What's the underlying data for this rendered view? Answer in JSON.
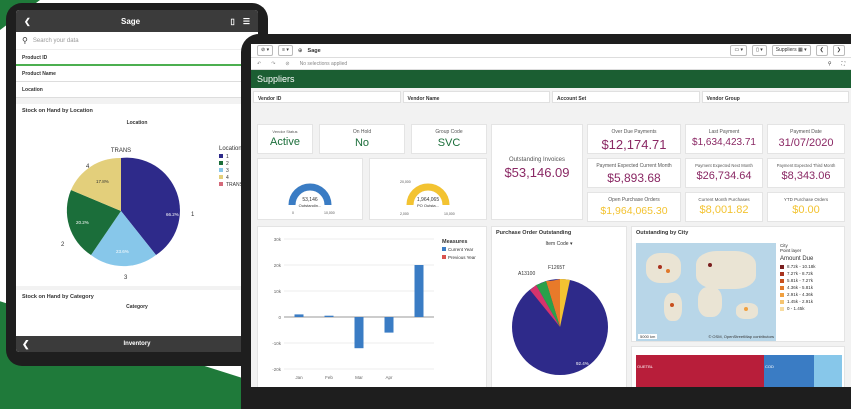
{
  "phone": {
    "title": "Sage",
    "search_placeholder": "Search your data",
    "fields": [
      "Product ID",
      "Product Name",
      "Location"
    ],
    "section_location": "Stock on Hand by Location",
    "location_chart_title": "Location",
    "pie_top_label": "TRANS",
    "legend_title": "Location",
    "legend_items": [
      "1",
      "2",
      "3",
      "4",
      "TRANS"
    ],
    "pie_outer_labels": [
      "1",
      "2",
      "3",
      "4"
    ],
    "pie_inner_labels": [
      "66.2%",
      "23.6%",
      "20.2%",
      "17.8%"
    ],
    "section_category": "Stock on Hand by Category",
    "category_chart_title": "Category",
    "bottom_title": "Inventory",
    "colors": {
      "dark": "#3b3b3b",
      "accent": "#4caf50"
    }
  },
  "tablet": {
    "toolbar_title": "Sage",
    "suppliers_label": "Suppliers",
    "selections_text": "No selections applied",
    "header_title": "Suppliers",
    "filters": [
      "Vendor ID",
      "Vendor Name",
      "Account Set",
      "Vendor Group"
    ],
    "vendor_status_label": "Vendor Status",
    "vendor_status_value": "Active",
    "on_hold_label": "On Hold",
    "on_hold_value": "No",
    "group_code_label": "Group Code",
    "group_code_value": "SVC",
    "gauge1_value": "53,146",
    "gauge1_sub": "Outstandin...",
    "gauge1_min": "0",
    "gauge1_max": "10,000",
    "gauge2_value": "1,964,065",
    "gauge2_sub": "PO Outsta...",
    "gauge2_min": "2,000",
    "gauge2_max": "10,000",
    "gauge2_top": "20,000",
    "outstanding_invoices_label": "Outstanding Invoices",
    "outstanding_invoices_value": "$53,146.09",
    "kpis": [
      {
        "label": "Over Due Payments",
        "value": "$12,174.71"
      },
      {
        "label": "Last Payment",
        "value": "$1,634,423.71"
      },
      {
        "label": "Payment Date",
        "value": "31/07/2020"
      },
      {
        "label": "Payment Expected Current Month",
        "value": "$5,893.68"
      },
      {
        "label": "Payment Expected Next Month",
        "value": "$26,734.64"
      },
      {
        "label": "Payment Expected Third Month",
        "value": "$8,343.06"
      },
      {
        "label": "Open Purchase Orders",
        "value": "$1,964,065.30"
      },
      {
        "label": "Current Month Purchases",
        "value": "$8,001.82"
      },
      {
        "label": "YTD Purchase Orders",
        "value": "$0.00"
      }
    ],
    "po_title": "Purchase Order Outstanding",
    "po_dropdown": "Item Code",
    "po_labels": [
      "F1265T",
      "A13100",
      "92.4%"
    ],
    "map_title": "Outstanding by City",
    "map_layer": "City\nPoint layer",
    "map_legend_title": "Amount Due",
    "map_legend": [
      "8.72k - 10.18k",
      "7.27k - 8.72k",
      "5.81k - 7.27k",
      "4.36k - 5.81k",
      "2.91k - 4.36k",
      "1.45k - 2.91k",
      "0 - 1.45k"
    ],
    "map_legend_colors": [
      "#7a1f1f",
      "#a8321e",
      "#c8501e",
      "#e0782a",
      "#f0a040",
      "#f5c470",
      "#f8dca0"
    ],
    "map_scale": "5000 km",
    "map_attribution": "© OSM, OpenStreetMap contributors",
    "treemap_labels": [
      "OUETBL",
      "COD"
    ]
  },
  "chart_data": {
    "type": "bar",
    "categories": [
      "Jan",
      "Feb",
      "Mar",
      "Apr"
    ],
    "series": [
      {
        "name": "Current Year",
        "values": [
          1000,
          500,
          -12000,
          -6000,
          20000
        ]
      },
      {
        "name": "Previous Year",
        "values": [
          0,
          0,
          0,
          0,
          0
        ]
      }
    ],
    "legend_title": "Measures",
    "ylim": [
      -20000,
      30000
    ],
    "yticks": [
      "30k",
      "20k",
      "10k",
      "0",
      "-10k",
      "-20k"
    ],
    "colors": [
      "#3a7cc4",
      "#d9534f"
    ]
  }
}
